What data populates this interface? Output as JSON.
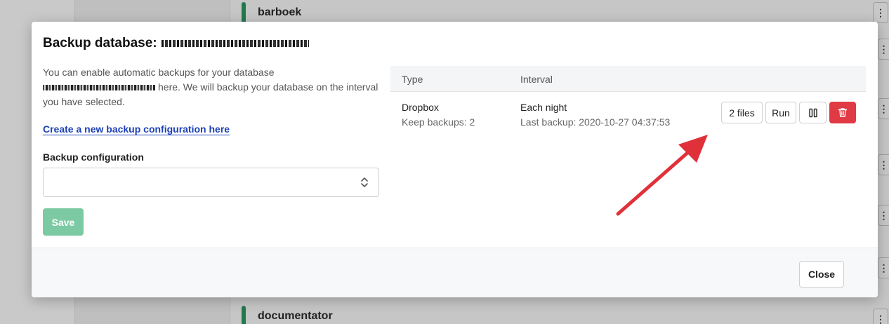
{
  "background": {
    "card_titles": [
      "barboek",
      "documentator"
    ]
  },
  "modal": {
    "title": "Backup database:",
    "description_pre": "You can enable automatic backups for your database",
    "description_post": "here. We will backup your database on the interval you have selected.",
    "create_link": "Create a new backup configuration here",
    "field_label": "Backup configuration",
    "select_value": "",
    "save_label": "Save",
    "close_label": "Close"
  },
  "table": {
    "headers": [
      "Type",
      "Interval"
    ],
    "rows": [
      {
        "type": "Dropbox",
        "keep": "Keep backups: 2",
        "interval": "Each night",
        "last_backup": "Last backup: 2020-10-27 04:37:53",
        "files_label": "2 files",
        "run_label": "Run"
      }
    ]
  },
  "colors": {
    "accent_green": "#7ccaa4",
    "danger": "#e03a44",
    "link": "#1a3fb5",
    "annotation_arrow": "#e0313b"
  },
  "icons": {
    "pause": "pause-icon",
    "delete": "trash-icon",
    "select": "chevron-updown-icon",
    "kebab": "kebab-icon"
  }
}
